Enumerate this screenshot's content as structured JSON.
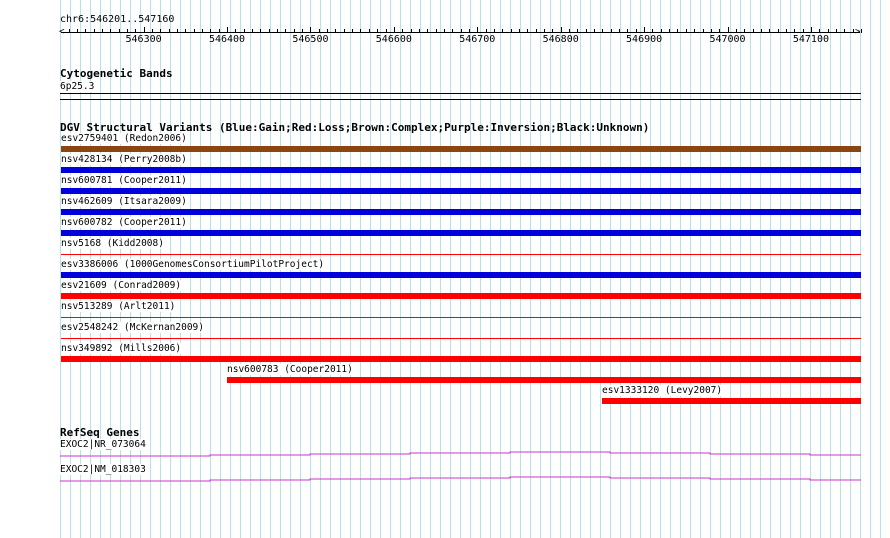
{
  "ruler": {
    "position": "chr6:546201..547160",
    "start": 546201,
    "end": 547160,
    "ticks": [
      546300,
      546400,
      546500,
      546600,
      546700,
      546800,
      546900,
      547000,
      547100
    ],
    "tick_labels": [
      "546300",
      "546400",
      "546500",
      "546600",
      "546700",
      "546800",
      "546900",
      "547000",
      "547100"
    ]
  },
  "cytoband": {
    "title": "Cytogenetic Bands",
    "band": "6p25.3"
  },
  "dgv": {
    "title": "DGV Structural Variants (Blue:Gain;Red:Loss;Brown:Complex;Purple:Inversion;Black:Unknown)",
    "colors": {
      "gain": "#0000dd",
      "loss": "#ff0000",
      "complex": "#8b4513"
    },
    "variants": [
      {
        "label": "esv2759401 (Redon2006)",
        "type": "complex",
        "start": 546201,
        "end": 547160
      },
      {
        "label": "nsv428134 (Perry2008b)",
        "type": "gain",
        "start": 546201,
        "end": 547160
      },
      {
        "label": "nsv600781 (Cooper2011)",
        "type": "gain",
        "start": 546201,
        "end": 547160
      },
      {
        "label": "nsv462609 (Itsara2009)",
        "type": "gain",
        "start": 546201,
        "end": 547160
      },
      {
        "label": "nsv600782 (Cooper2011)",
        "type": "gain",
        "start": 546201,
        "end": 547160
      },
      {
        "label": "nsv5168 (Kidd2008)",
        "type": "loss",
        "start": 546201,
        "end": 547160
      },
      {
        "label": "esv3386006 (1000GenomesConsortiumPilotProject)",
        "type": "gain",
        "start": 546201,
        "end": 547160
      },
      {
        "label": "esv21609 (Conrad2009)",
        "type": "loss",
        "start": 546201,
        "end": 547160
      },
      {
        "label": "nsv513289 (Arlt2011)",
        "type": "loss",
        "start": 546201,
        "end": 547160
      },
      {
        "label": "esv2548242 (McKernan2009)",
        "type": "loss",
        "start": 546201,
        "end": 547160
      },
      {
        "label": "nsv349892 (Mills2006)",
        "type": "loss",
        "start": 546201,
        "end": 547160
      },
      {
        "label": "nsv600783 (Cooper2011)",
        "type": "loss",
        "start": 546400,
        "end": 547160
      },
      {
        "label": "esv1333120 (Levy2007)",
        "type": "loss",
        "start": 546850,
        "end": 547160
      }
    ]
  },
  "refseq": {
    "title": "RefSeq Genes",
    "color": "#cc33cc",
    "genes": [
      {
        "label": "EXOC2|NR_073064"
      },
      {
        "label": "EXOC2|NM_018303"
      }
    ]
  }
}
